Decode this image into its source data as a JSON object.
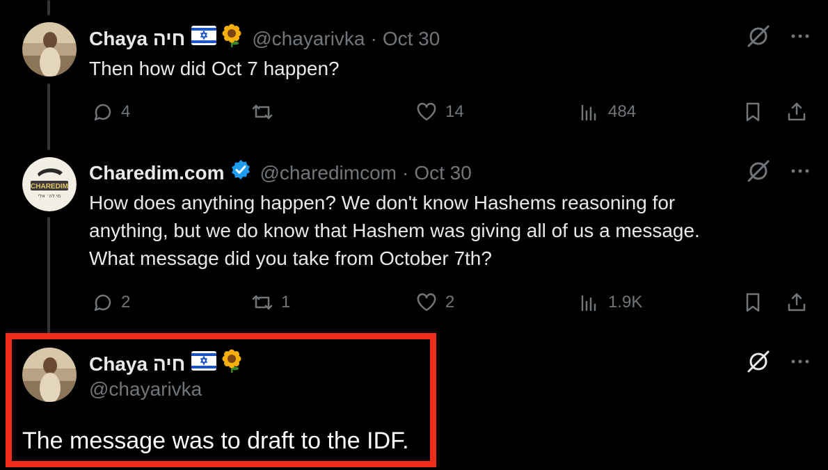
{
  "tweets": [
    {
      "display_name": "Chaya חיה",
      "handle": "@chayarivka",
      "separator": "·",
      "date": "Oct 30",
      "verified": false,
      "badges": [
        "israel-flag-emoji",
        "sunflower-emoji"
      ],
      "text": "Then how did Oct 7 happen?",
      "replies": "4",
      "reposts": "",
      "likes": "14",
      "views": "484"
    },
    {
      "display_name": "Charedim.com",
      "handle": "@charedimcom",
      "separator": "·",
      "date": "Oct 30",
      "verified": true,
      "avatar_text": "CHAREDIM",
      "avatar_subtext": "מי לה׳ אלי",
      "text_lines": [
        "How does anything happen? We don't know Hashems reasoning for",
        "anything, but we do know that Hashem was giving all of us a message.",
        "What message did you take from October 7th?"
      ],
      "replies": "2",
      "reposts": "1",
      "likes": "2",
      "views": "1.9K"
    },
    {
      "display_name": "Chaya חיה",
      "handle": "@chayarivka",
      "verified": false,
      "badges": [
        "israel-flag-emoji",
        "sunflower-emoji"
      ],
      "text": "The message was to draft to the IDF."
    }
  ],
  "colors": {
    "background": "#000000",
    "primary_text": "#e7e9ea",
    "secondary_text": "#71767b",
    "verified_blue": "#1d9bf0",
    "highlight_red": "#f02d1b"
  }
}
